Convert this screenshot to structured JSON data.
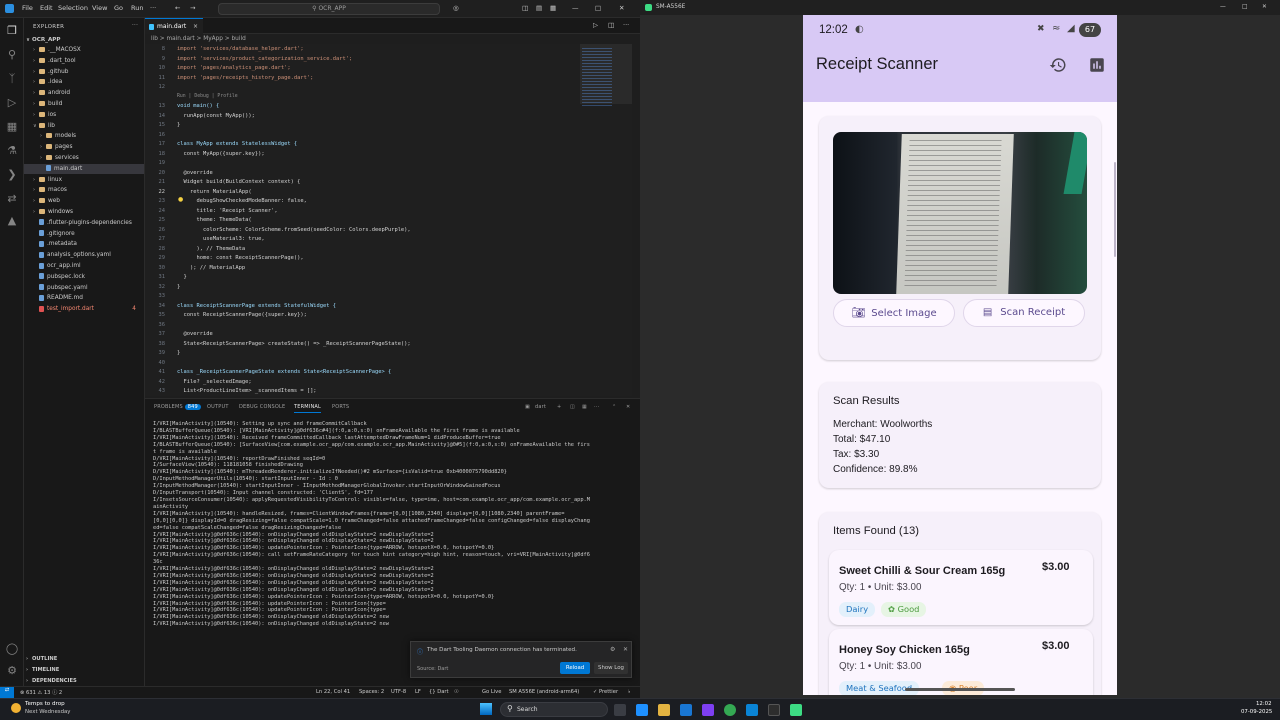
{
  "vscode": {
    "menu": [
      "File",
      "Edit",
      "Selection",
      "View",
      "Go",
      "Run"
    ],
    "command_center": "OCR_APP",
    "explorer": {
      "header": "EXPLORER",
      "project": "OCR_APP",
      "tree": [
        {
          "label": ".__MACOSX",
          "type": "folder",
          "depth": 1
        },
        {
          "label": ".dart_tool",
          "type": "folder",
          "depth": 1
        },
        {
          "label": ".github",
          "type": "folder",
          "depth": 1
        },
        {
          "label": ".idea",
          "type": "folder",
          "depth": 1
        },
        {
          "label": "android",
          "type": "folder",
          "depth": 1
        },
        {
          "label": "build",
          "type": "folder",
          "depth": 1
        },
        {
          "label": "ios",
          "type": "folder",
          "depth": 1
        },
        {
          "label": "lib",
          "type": "folder",
          "depth": 1,
          "open": true
        },
        {
          "label": "models",
          "type": "folder",
          "depth": 2
        },
        {
          "label": "pages",
          "type": "folder",
          "depth": 2
        },
        {
          "label": "services",
          "type": "folder",
          "depth": 2
        },
        {
          "label": "main.dart",
          "type": "file",
          "depth": 2,
          "selected": true
        },
        {
          "label": "linux",
          "type": "folder",
          "depth": 1
        },
        {
          "label": "macos",
          "type": "folder",
          "depth": 1
        },
        {
          "label": "web",
          "type": "folder",
          "depth": 1
        },
        {
          "label": "windows",
          "type": "folder",
          "depth": 1
        },
        {
          "label": ".flutter-plugins-dependencies",
          "type": "file",
          "depth": 1
        },
        {
          "label": ".gitignore",
          "type": "file",
          "depth": 1
        },
        {
          "label": ".metadata",
          "type": "file",
          "depth": 1
        },
        {
          "label": "analysis_options.yaml",
          "type": "file",
          "depth": 1
        },
        {
          "label": "ocr_app.iml",
          "type": "file",
          "depth": 1
        },
        {
          "label": "pubspec.lock",
          "type": "file",
          "depth": 1
        },
        {
          "label": "pubspec.yaml",
          "type": "file",
          "depth": 1
        },
        {
          "label": "README.md",
          "type": "file",
          "depth": 1
        },
        {
          "label": "test_import.dart",
          "type": "file",
          "depth": 1,
          "error": true,
          "badge": "4"
        }
      ],
      "bottom_sections": [
        "OUTLINE",
        "TIMELINE",
        "DEPENDENCIES"
      ]
    },
    "tab": "main.dart",
    "breadcrumb": "lib  >  main.dart  >  MyApp  >  build",
    "code_lines": [
      {
        "n": "8",
        "t": "import 'services/database_helper.dart';"
      },
      {
        "n": "9",
        "t": "import 'services/product_categorization_service.dart';"
      },
      {
        "n": "10",
        "t": "import 'pages/analytics_page.dart';"
      },
      {
        "n": "11",
        "t": "import 'pages/receipts_history_page.dart';"
      },
      {
        "n": "12",
        "t": ""
      },
      {
        "n": "",
        "t": "Run | Debug | Profile"
      },
      {
        "n": "13",
        "t": "void main() {"
      },
      {
        "n": "14",
        "t": "  runApp(const MyApp());"
      },
      {
        "n": "15",
        "t": "}"
      },
      {
        "n": "16",
        "t": ""
      },
      {
        "n": "17",
        "t": "class MyApp extends StatelessWidget {"
      },
      {
        "n": "18",
        "t": "  const MyApp({super.key});"
      },
      {
        "n": "19",
        "t": ""
      },
      {
        "n": "20",
        "t": "  @override"
      },
      {
        "n": "21",
        "t": "  Widget build(BuildContext context) {"
      },
      {
        "n": "22",
        "t": "    return MaterialApp("
      },
      {
        "n": "23",
        "t": "      debugShowCheckedModeBanner: false,"
      },
      {
        "n": "24",
        "t": "      title: 'Receipt Scanner',"
      },
      {
        "n": "25",
        "t": "      theme: ThemeData("
      },
      {
        "n": "26",
        "t": "        colorScheme: ColorScheme.fromSeed(seedColor: Colors.deepPurple),"
      },
      {
        "n": "27",
        "t": "        useMaterial3: true,"
      },
      {
        "n": "28",
        "t": "      ), // ThemeData"
      },
      {
        "n": "29",
        "t": "      home: const ReceiptScannerPage(),"
      },
      {
        "n": "30",
        "t": "    ); // MaterialApp"
      },
      {
        "n": "31",
        "t": "  }"
      },
      {
        "n": "32",
        "t": "}"
      },
      {
        "n": "33",
        "t": ""
      },
      {
        "n": "34",
        "t": "class ReceiptScannerPage extends StatefulWidget {"
      },
      {
        "n": "35",
        "t": "  const ReceiptScannerPage({super.key});"
      },
      {
        "n": "36",
        "t": ""
      },
      {
        "n": "37",
        "t": "  @override"
      },
      {
        "n": "38",
        "t": "  State<ReceiptScannerPage> createState() => _ReceiptScannerPageState();"
      },
      {
        "n": "39",
        "t": "}"
      },
      {
        "n": "40",
        "t": ""
      },
      {
        "n": "41",
        "t": "class _ReceiptScannerPageState extends State<ReceiptScannerPage> {"
      },
      {
        "n": "42",
        "t": "  File? _selectedImage;"
      },
      {
        "n": "43",
        "t": "  List<ProductLineItem> _scannedItems = [];"
      }
    ],
    "panel_tabs": [
      "PROBLEMS",
      "OUTPUT",
      "DEBUG CONSOLE",
      "TERMINAL",
      "PORTS"
    ],
    "problems_badge": "849",
    "terminal_name": "dart",
    "terminal_lines": [
      "I/VRI[MainActivity](10540): Setting up sync and frameCommitCallback",
      "I/BLASTBufferQueue(10540): [VRI[MainActivity]@0df636c#4](f:0,a:0,s:0) onFrameAvailable the first frame is available",
      "I/VRI[MainActivity](10540): Received frameCommittedCallback lastAttemptedDrawFrameNum=1 didProduceBuffer=true",
      "I/BLASTBufferQueue(10540): [SurfaceView[com.example.ocr_app/com.example.ocr_app.MainActivity]@0#5](f:0,a:0,s:0) onFrameAvailable the firs",
      "t frame is available",
      "D/VRI[MainActivity](10540): reportDrawFinished seqId=0",
      "I/SurfaceView(10540): 118181058 finishedDrawing",
      "D/VRI[MainActivity](10540): mThreadedRenderer.initializeIfNeeded()#2 mSurface={isValid=true 0xb4000075790dd820}",
      "D/InputMethodManagerUtils(10540): startInputInner - Id : 0",
      "I/InputMethodManager(10540): startInputInner - IInputMethodManagerGlobalInvoker.startInputOrWindowGainedFocus",
      "D/InputTransport(10540): Input channel constructed: 'ClientS', fd=177",
      "I/InsetsSourceConsumer(10540): applyRequestedVisibilityToControl: visible=false, type=ime, host=com.example.ocr_app/com.example.ocr_app.M",
      "ainActivity",
      "I/VRI[MainActivity](10540): handleResized, frames=ClientWindowFrames{frame=[0,0][1080,2340] display=[0,0][1080,2340] parentFrame=",
      "[0,0][0,0]} displayId=0 dragResizing=false compatScale=1.0 frameChanged=false attachedFrameChanged=false configChanged=false displayChang",
      "ed=false compatScaleChanged=false dragResizingChanged=false",
      "I/VRI[MainActivity]@0df636c(10540): onDisplayChanged oldDisplayState=2 newDisplayState=2",
      "I/VRI[MainActivity]@0df636c(10540): onDisplayChanged oldDisplayState=2 newDisplayState=2",
      "I/VRI[MainActivity]@0df636c(10540): updatePointerIcon : PointerIcon{type=ARROW, hotspotX=0.0, hotspotY=0.0}",
      "I/VRI[MainActivity]@0df636c(10540): call setFrameRateCategory for touch hint category=high hint, reason=touch, vri=VRI[MainActivity]@0df6",
      "36c",
      "I/VRI[MainActivity]@0df636c(10540): onDisplayChanged oldDisplayState=2 newDisplayState=2",
      "I/VRI[MainActivity]@0df636c(10540): onDisplayChanged oldDisplayState=2 newDisplayState=2",
      "I/VRI[MainActivity]@0df636c(10540): onDisplayChanged oldDisplayState=2 newDisplayState=2",
      "I/VRI[MainActivity]@0df636c(10540): onDisplayChanged oldDisplayState=2 newDisplayState=2",
      "I/VRI[MainActivity]@0df636c(10540): updatePointerIcon : PointerIcon{type=ARROW, hotspotX=0.0, hotspotY=0.0}",
      "I/VRI[MainActivity]@0df636c(10540): updatePointerIcon : PointerIcon{type=",
      "I/VRI[MainActivity]@0df636c(10540): updatePointerIcon : PointerIcon{type=",
      "I/VRI[MainActivity]@0df636c(10540): onDisplayChanged oldDisplayState=2 new",
      "I/VRI[MainActivity]@0df636c(10540): onDisplayChanged oldDisplayState=2 new"
    ],
    "toast": {
      "message": "The Dart Tooling Daemon connection has terminated.",
      "source": "Source: Dart",
      "reload": "Reload",
      "show_log": "Show Log"
    },
    "statusbar": {
      "problems": "⊗ 631  ⚠ 13  ⓘ 2",
      "position": "Ln 22, Col 41",
      "spaces": "Spaces: 2",
      "encoding": "UTF-8",
      "eol": "LF",
      "language": "{} Dart",
      "golive": "Go Live",
      "device": "SM A556E (android-arm64)",
      "prettier": "✓ Prettier"
    }
  },
  "emulator": {
    "window_title": "SM-A556E",
    "phone_status": {
      "time": "12:02",
      "battery": "67"
    },
    "app": {
      "title": "Receipt Scanner",
      "select_image": "Select Image",
      "scan_receipt": "Scan Receipt",
      "scan_results": {
        "title": "Scan Results",
        "merchant": "Merchant: Woolworths",
        "total": "Total: $47.10",
        "tax": "Tax: $3.30",
        "confidence": "Confidence: 89.8%"
      },
      "items_title": "Items Found (13)",
      "items": [
        {
          "name": "Sweet Chilli & Sour Cream 165g",
          "price": "$3.00",
          "detail": "Qty: 1 • Unit: $3.00",
          "category": "Dairy",
          "rating": "Good"
        },
        {
          "name": "Honey Soy Chicken 165g",
          "price": "$3.00",
          "detail": "Qty: 1 • Unit: $3.00",
          "category": "Meat & Seafood",
          "rating": "Poor"
        }
      ]
    }
  },
  "taskbar": {
    "weather_title": "Temps to drop",
    "weather_sub": "Next Wednesday",
    "search": "Search",
    "time": "12:02",
    "date": "07-09-2025"
  },
  "colors": {
    "accent": "#0078d4",
    "appbar": "#d8c9f5",
    "brand": "#5b4a8e",
    "dairy_bg": "#e3f0fb",
    "good_bg": "#e7f5e4",
    "meat_bg": "#e3f0fb",
    "poor_bg": "#fdebd9"
  }
}
